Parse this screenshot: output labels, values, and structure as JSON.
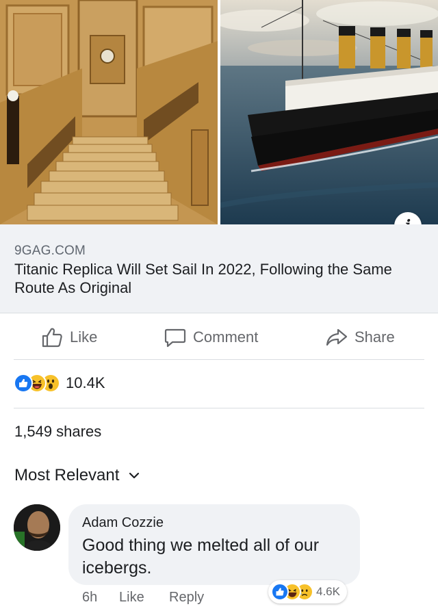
{
  "link_preview": {
    "images": [
      "Grand staircase",
      "Ship at sea"
    ],
    "domain": "9GAG.COM",
    "title": "Titanic Replica Will Set Sail In 2022, Following the Same Route As Original",
    "info_icon": "info-icon"
  },
  "actions": {
    "like": "Like",
    "comment": "Comment",
    "share": "Share"
  },
  "reactions": {
    "icons": [
      "like-reaction-icon",
      "haha-reaction-icon",
      "wow-reaction-icon"
    ],
    "count": "10.4K"
  },
  "shares": "1,549 shares",
  "sort": {
    "label": "Most Relevant"
  },
  "comment": {
    "author": "Adam Cozzie",
    "text": "Good thing we melted all of our icebergs.",
    "time": "6h",
    "like": "Like",
    "reply": "Reply",
    "reactions": [
      "like-reaction-icon",
      "haha-reaction-icon",
      "sad-reaction-icon"
    ],
    "reaction_count": "4.6K"
  },
  "colors": {
    "like_blue": "#1877f2",
    "emoji_yellow": "#f7c12a",
    "secondary_text": "#65676b",
    "link_bg": "#f0f2f5"
  }
}
